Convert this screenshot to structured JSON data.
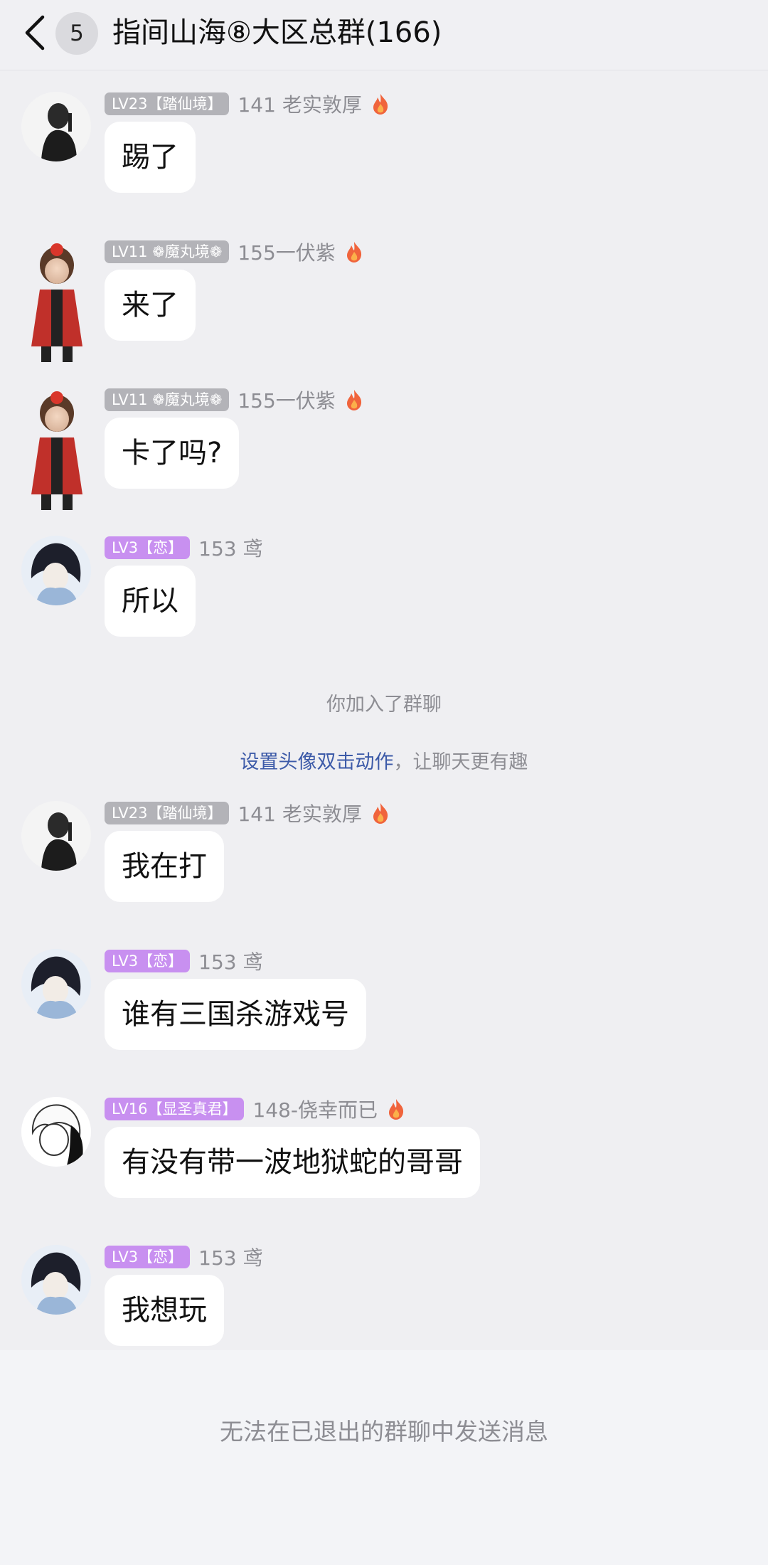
{
  "header": {
    "unread_count": "5",
    "title": "指间山海⑧大区总群(166)"
  },
  "messages": [
    {
      "level": "LV23【踏仙境】",
      "name": "141 老实敦厚",
      "text": "踢了"
    },
    {
      "level": "LV11 ❁魔丸境❁",
      "name": "155一伏紫",
      "text": "来了"
    },
    {
      "level": "LV11 ❁魔丸境❁",
      "name": "155一伏紫",
      "text": "卡了吗?"
    },
    {
      "level": "LV3【恋】",
      "name": "153 鸢",
      "text": "所以"
    },
    {
      "level": "LV23【踏仙境】",
      "name": "141 老实敦厚",
      "text": "我在打"
    },
    {
      "level": "LV3【恋】",
      "name": "153 鸢",
      "text": "谁有三国杀游戏号"
    },
    {
      "level": "LV16【显圣真君】",
      "name": "148-侥幸而已",
      "text": "有没有带一波地狱蛇的哥哥"
    },
    {
      "level": "LV3【恋】",
      "name": "153 鸢",
      "text": "我想玩"
    }
  ],
  "system": {
    "joined": "你加入了群聊",
    "tip_link": "设置头像双击动作",
    "tip_rest": "，让聊天更有趣"
  },
  "footer": {
    "notice": "无法在已退出的群聊中发送消息"
  },
  "colors": {
    "badge_gray": "#B3B3B8",
    "badge_purple": "#C890F0",
    "link": "#3C5AA8",
    "flame": "#F0643C"
  }
}
